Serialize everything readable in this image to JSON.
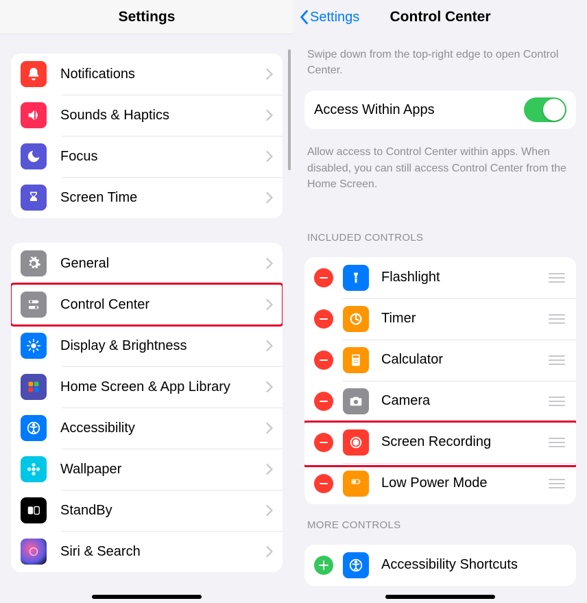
{
  "left": {
    "title": "Settings",
    "group1": [
      {
        "label": "Notifications",
        "icon": "bell",
        "bg": "#ff3b30"
      },
      {
        "label": "Sounds & Haptics",
        "icon": "speaker",
        "bg": "#ff2d55"
      },
      {
        "label": "Focus",
        "icon": "moon",
        "bg": "#5856d6"
      },
      {
        "label": "Screen Time",
        "icon": "hourglass",
        "bg": "#5856d6"
      }
    ],
    "group2": [
      {
        "label": "General",
        "icon": "gear",
        "bg": "#8e8e93"
      },
      {
        "label": "Control Center",
        "icon": "switches",
        "bg": "#8e8e93",
        "highlighted": true
      },
      {
        "label": "Display & Brightness",
        "icon": "sun",
        "bg": "#007aff"
      },
      {
        "label": "Home Screen & App Library",
        "icon": "grid",
        "bg": "#4b4db2"
      },
      {
        "label": "Accessibility",
        "icon": "accessibility",
        "bg": "#007aff"
      },
      {
        "label": "Wallpaper",
        "icon": "flower",
        "bg": "#00c7e6"
      },
      {
        "label": "StandBy",
        "icon": "standby",
        "bg": "#000000"
      },
      {
        "label": "Siri & Search",
        "icon": "siri",
        "bg": "#000000"
      }
    ]
  },
  "right": {
    "back": "Settings",
    "title": "Control Center",
    "desc": "Swipe down from the top-right edge to open Control Center.",
    "access_label": "Access Within Apps",
    "access_on": true,
    "access_help": "Allow access to Control Center within apps. When disabled, you can still access Control Center from the Home Screen.",
    "included_label": "INCLUDED CONTROLS",
    "included": [
      {
        "label": "Flashlight",
        "icon": "flashlight",
        "bg": "#007aff"
      },
      {
        "label": "Timer",
        "icon": "timer",
        "bg": "#ff9500"
      },
      {
        "label": "Calculator",
        "icon": "calculator",
        "bg": "#ff9500"
      },
      {
        "label": "Camera",
        "icon": "camera",
        "bg": "#8e8e93"
      },
      {
        "label": "Screen Recording",
        "icon": "record",
        "bg": "#ff3b30",
        "highlighted": true
      },
      {
        "label": "Low Power Mode",
        "icon": "battery",
        "bg": "#ff9500"
      }
    ],
    "more_label": "MORE CONTROLS",
    "more": [
      {
        "label": "Accessibility Shortcuts",
        "icon": "accessibility",
        "bg": "#007aff"
      }
    ]
  }
}
